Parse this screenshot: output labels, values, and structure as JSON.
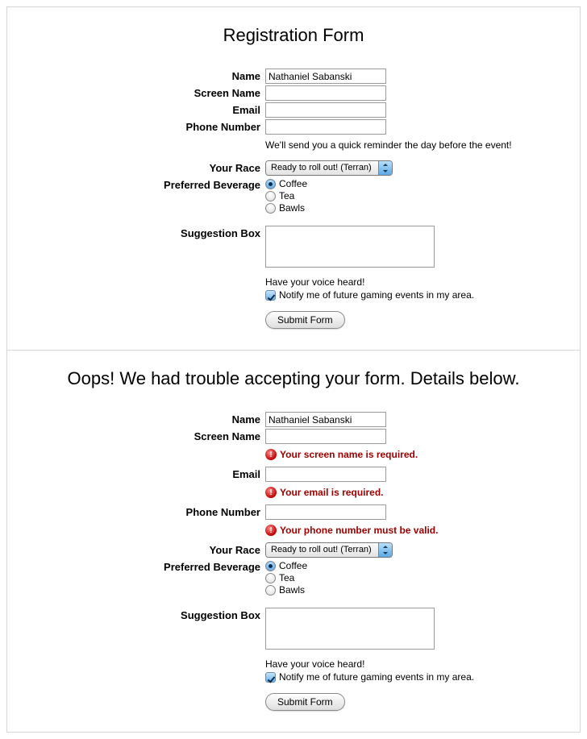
{
  "form1": {
    "title": "Registration Form",
    "labels": {
      "name": "Name",
      "screen_name": "Screen Name",
      "email": "Email",
      "phone": "Phone Number",
      "race": "Your Race",
      "beverage": "Preferred Beverage",
      "suggestion": "Suggestion Box"
    },
    "values": {
      "name": "Nathaniel Sabanski",
      "screen_name": "",
      "email": "",
      "phone": "",
      "suggestion": ""
    },
    "phone_helper": "We'll send you a quick reminder the day before the event!",
    "race_selected": "Ready to roll out! (Terran)",
    "beverage_options": {
      "opt0": "Coffee",
      "opt1": "Tea",
      "opt2": "Bawls"
    },
    "suggestion_helper": "Have your voice heard!",
    "notify_label": "Notify me of future gaming events in my area.",
    "submit_label": "Submit Form"
  },
  "form2": {
    "title": "Oops! We had trouble accepting your form. Details below.",
    "labels": {
      "name": "Name",
      "screen_name": "Screen Name",
      "email": "Email",
      "phone": "Phone Number",
      "race": "Your Race",
      "beverage": "Preferred Beverage",
      "suggestion": "Suggestion Box"
    },
    "values": {
      "name": "Nathaniel Sabanski",
      "screen_name": "",
      "email": "",
      "phone": "",
      "suggestion": ""
    },
    "errors": {
      "screen_name": "Your screen name is required.",
      "email": "Your email is required.",
      "phone": "Your phone number must be valid."
    },
    "error_glyph": "!",
    "race_selected": "Ready to roll out! (Terran)",
    "beverage_options": {
      "opt0": "Coffee",
      "opt1": "Tea",
      "opt2": "Bawls"
    },
    "suggestion_helper": "Have your voice heard!",
    "notify_label": "Notify me of future gaming events in my area.",
    "submit_label": "Submit Form"
  }
}
